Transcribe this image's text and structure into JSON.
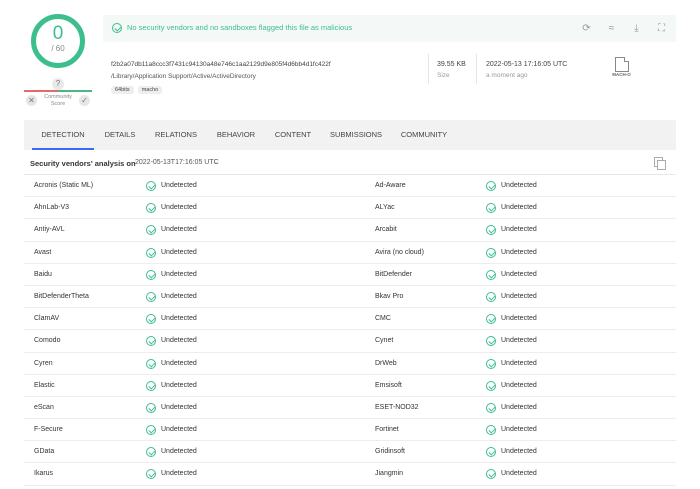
{
  "score": {
    "detections": "0",
    "total": "/ 60"
  },
  "community": {
    "question": "?",
    "label": "Community Score"
  },
  "banner": {
    "message": "No security vendors and no sandboxes flagged this file as malicious"
  },
  "file": {
    "hash": "f2b2a07db11a8ccc3f7431c94130a48e746c1aa2129d9e805f4d6bb4d1fc422f",
    "path": "/Library/Application Support/Active/ActiveDirectory",
    "tags": [
      "64bits",
      "macho"
    ],
    "size": "39.55 KB",
    "size_label": "Size",
    "date": "2022-05-13 17:16:05 UTC",
    "date_label": "a moment ago",
    "type": "MACH-O"
  },
  "tabs": [
    "DETECTION",
    "DETAILS",
    "RELATIONS",
    "BEHAVIOR",
    "CONTENT",
    "SUBMISSIONS",
    "COMMUNITY"
  ],
  "vendors": {
    "title": "Security vendors' analysis on",
    "date": "2022-05-13T17:16:05 UTC",
    "rows": [
      {
        "left": "Acronis (Static ML)",
        "left_status": "Undetected",
        "right": "Ad-Aware",
        "right_status": "Undetected"
      },
      {
        "left": "AhnLab-V3",
        "left_status": "Undetected",
        "right": "ALYac",
        "right_status": "Undetected"
      },
      {
        "left": "Antiy-AVL",
        "left_status": "Undetected",
        "right": "Arcabit",
        "right_status": "Undetected"
      },
      {
        "left": "Avast",
        "left_status": "Undetected",
        "right": "Avira (no cloud)",
        "right_status": "Undetected"
      },
      {
        "left": "Baidu",
        "left_status": "Undetected",
        "right": "BitDefender",
        "right_status": "Undetected"
      },
      {
        "left": "BitDefenderTheta",
        "left_status": "Undetected",
        "right": "Bkav Pro",
        "right_status": "Undetected"
      },
      {
        "left": "ClamAV",
        "left_status": "Undetected",
        "right": "CMC",
        "right_status": "Undetected"
      },
      {
        "left": "Comodo",
        "left_status": "Undetected",
        "right": "Cynet",
        "right_status": "Undetected"
      },
      {
        "left": "Cyren",
        "left_status": "Undetected",
        "right": "DrWeb",
        "right_status": "Undetected"
      },
      {
        "left": "Elastic",
        "left_status": "Undetected",
        "right": "Emsisoft",
        "right_status": "Undetected"
      },
      {
        "left": "eScan",
        "left_status": "Undetected",
        "right": "ESET-NOD32",
        "right_status": "Undetected"
      },
      {
        "left": "F-Secure",
        "left_status": "Undetected",
        "right": "Fortinet",
        "right_status": "Undetected"
      },
      {
        "left": "GData",
        "left_status": "Undetected",
        "right": "Gridinsoft",
        "right_status": "Undetected"
      },
      {
        "left": "Ikarus",
        "left_status": "Undetected",
        "right": "Jiangmin",
        "right_status": "Undetected"
      }
    ]
  },
  "colors": {
    "accent": "#3cbf8c",
    "tab_active": "#3b68ff",
    "negative": "#e46b6b"
  }
}
